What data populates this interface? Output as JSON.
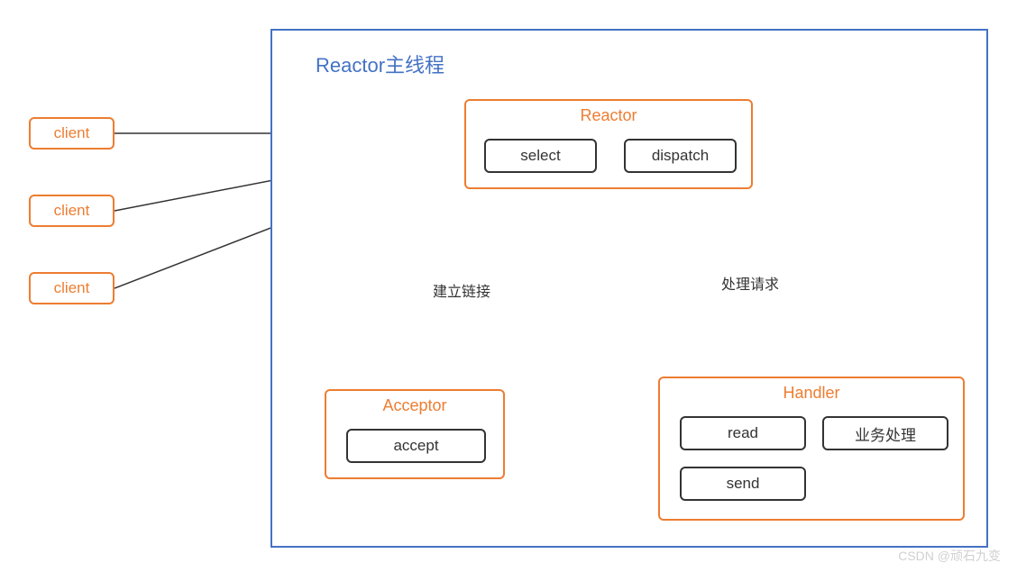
{
  "container": {
    "title": "Reactor主线程"
  },
  "clients": [
    {
      "label": "client"
    },
    {
      "label": "client"
    },
    {
      "label": "client"
    }
  ],
  "reactor": {
    "title": "Reactor",
    "select_label": "select",
    "dispatch_label": "dispatch"
  },
  "acceptor": {
    "title": "Acceptor",
    "accept_label": "accept"
  },
  "handler": {
    "title": "Handler",
    "read_label": "read",
    "business_label": "业务处理",
    "send_label": "send"
  },
  "edges": {
    "connect_label": "建立链接",
    "request_label": "处理请求"
  },
  "watermark": "CSDN @顽石九变"
}
